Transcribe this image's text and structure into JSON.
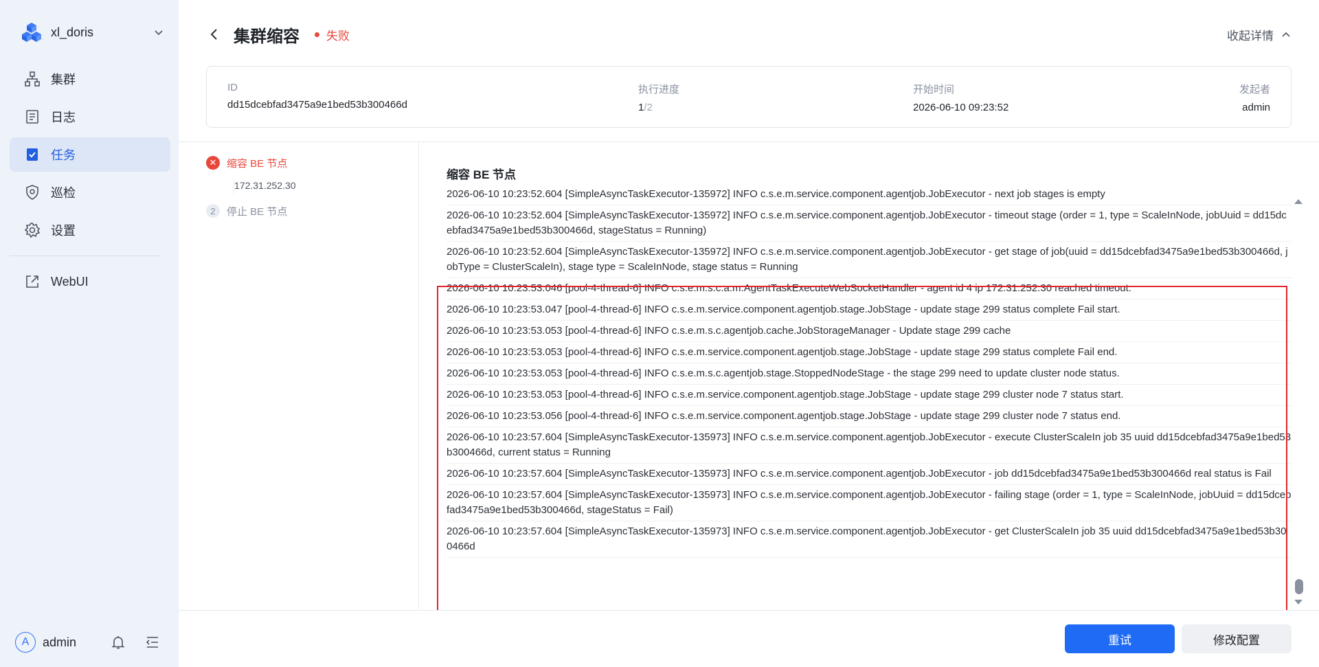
{
  "sidebar": {
    "brand": "xl_doris",
    "items": [
      {
        "label": "集群",
        "icon": "cluster-icon"
      },
      {
        "label": "日志",
        "icon": "log-icon"
      },
      {
        "label": "任务",
        "icon": "task-icon"
      },
      {
        "label": "巡检",
        "icon": "shield-icon"
      },
      {
        "label": "设置",
        "icon": "gear-icon"
      },
      {
        "label": "WebUI",
        "icon": "external-link-icon"
      }
    ],
    "active_item": "任务",
    "user": {
      "avatar_letter": "A",
      "name": "admin"
    }
  },
  "header": {
    "title": "集群缩容",
    "status": "失败",
    "collapse_label": "收起详情"
  },
  "info": {
    "id_label": "ID",
    "id_value": "dd15dcebfad3475a9e1bed53b300466d",
    "progress_label": "执行进度",
    "progress_current": "1",
    "progress_total": "/2",
    "start_label": "开始时间",
    "start_value": "2026-06-10 09:23:52",
    "initiator_label": "发起者",
    "initiator_value": "admin"
  },
  "steps": [
    {
      "num": "✕",
      "label": "缩容 BE 节点",
      "status": "fail",
      "sub": "172.31.252.30"
    },
    {
      "num": "2",
      "label": "停止 BE 节点",
      "status": "todo"
    }
  ],
  "log": {
    "title": "缩容 BE 节点",
    "lines": [
      "2026-06-10 10:23:52.604 [SimpleAsyncTaskExecutor-135972] INFO  c.s.e.m.service.component.agentjob.JobExecutor - next job stages is empty",
      "2026-06-10 10:23:52.604 [SimpleAsyncTaskExecutor-135972] INFO  c.s.e.m.service.component.agentjob.JobExecutor - timeout stage (order = 1, type = ScaleInNode, jobUuid = dd15dcebfad3475a9e1bed53b300466d, stageStatus = Running)",
      "2026-06-10 10:23:52.604 [SimpleAsyncTaskExecutor-135972] INFO  c.s.e.m.service.component.agentjob.JobExecutor - get stage of job(uuid = dd15dcebfad3475a9e1bed53b300466d, jobType = ClusterScaleIn), stage type = ScaleInNode, stage status = Running",
      "2026-06-10 10:23:53.046 [pool-4-thread-6] INFO  c.s.e.m.s.c.a.m.AgentTaskExecuteWebSocketHandler - agent id 4 ip 172.31.252.30 reached timeout.",
      "2026-06-10 10:23:53.047 [pool-4-thread-6] INFO  c.s.e.m.service.component.agentjob.stage.JobStage - update stage 299 status complete Fail start.",
      "2026-06-10 10:23:53.053 [pool-4-thread-6] INFO  c.s.e.m.s.c.agentjob.cache.JobStorageManager - Update stage 299 cache",
      "2026-06-10 10:23:53.053 [pool-4-thread-6] INFO  c.s.e.m.service.component.agentjob.stage.JobStage - update stage 299 status complete Fail end.",
      "2026-06-10 10:23:53.053 [pool-4-thread-6] INFO  c.s.e.m.s.c.agentjob.stage.StoppedNodeStage - the stage 299 need to update cluster node status.",
      "2026-06-10 10:23:53.053 [pool-4-thread-6] INFO  c.s.e.m.service.component.agentjob.stage.JobStage - update stage 299 cluster node 7 status start.",
      "2026-06-10 10:23:53.056 [pool-4-thread-6] INFO  c.s.e.m.service.component.agentjob.stage.JobStage - update stage 299 cluster node 7 status end.",
      "2026-06-10 10:23:57.604 [SimpleAsyncTaskExecutor-135973] INFO  c.s.e.m.service.component.agentjob.JobExecutor - execute ClusterScaleIn job 35 uuid dd15dcebfad3475a9e1bed53b300466d, current status = Running",
      "2026-06-10 10:23:57.604 [SimpleAsyncTaskExecutor-135973] INFO  c.s.e.m.service.component.agentjob.JobExecutor - job dd15dcebfad3475a9e1bed53b300466d real status is Fail",
      "2026-06-10 10:23:57.604 [SimpleAsyncTaskExecutor-135973] INFO  c.s.e.m.service.component.agentjob.JobExecutor - failing stage (order = 1, type = ScaleInNode, jobUuid = dd15dcebfad3475a9e1bed53b300466d, stageStatus = Fail)",
      "2026-06-10 10:23:57.604 [SimpleAsyncTaskExecutor-135973] INFO  c.s.e.m.service.component.agentjob.JobExecutor - get ClusterScaleIn job 35 uuid dd15dcebfad3475a9e1bed53b300466d"
    ]
  },
  "footer": {
    "retry_label": "重试",
    "modify_label": "修改配置"
  },
  "colors": {
    "accent": "#1f6bf5",
    "fail": "#e8473a",
    "sidebar_bg": "#eef2f9",
    "highlight_border": "#e0242c"
  }
}
